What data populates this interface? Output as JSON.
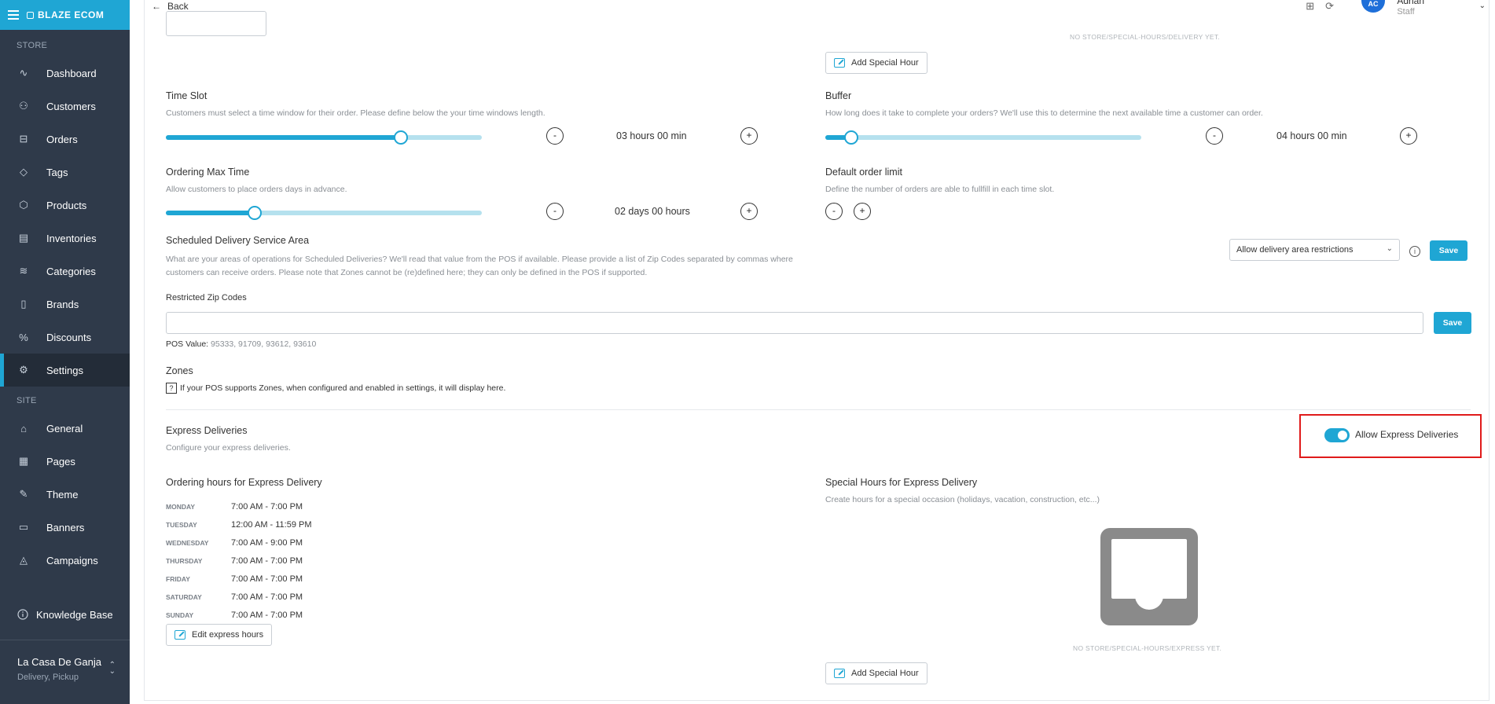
{
  "brand": {
    "name": "BLAZE ECOM"
  },
  "sidebar": {
    "store_section": "STORE",
    "site_section": "SITE",
    "store_items": [
      {
        "label": "Dashboard",
        "icon": "activity-icon"
      },
      {
        "label": "Customers",
        "icon": "users-icon"
      },
      {
        "label": "Orders",
        "icon": "inbox-icon"
      },
      {
        "label": "Tags",
        "icon": "tag-icon"
      },
      {
        "label": "Products",
        "icon": "box-icon"
      },
      {
        "label": "Inventories",
        "icon": "clipboard-icon"
      },
      {
        "label": "Categories",
        "icon": "layers-icon"
      },
      {
        "label": "Brands",
        "icon": "book-icon"
      },
      {
        "label": "Discounts",
        "icon": "percent-icon"
      },
      {
        "label": "Settings",
        "icon": "gear-icon",
        "active": true
      }
    ],
    "site_items": [
      {
        "label": "General",
        "icon": "home-icon"
      },
      {
        "label": "Pages",
        "icon": "layout-icon"
      },
      {
        "label": "Theme",
        "icon": "brush-icon"
      },
      {
        "label": "Banners",
        "icon": "monitor-icon"
      },
      {
        "label": "Campaigns",
        "icon": "bell-icon"
      }
    ],
    "knowledge_base": "Knowledge Base",
    "store": {
      "name": "La Casa De Ganja",
      "sub": "Delivery, Pickup"
    }
  },
  "topbar": {
    "back_label": "Back",
    "user_initials": "AC",
    "user_name": "Adrian",
    "user_role": "Staff"
  },
  "scheduled": {
    "empty_label": "NO STORE/SPECIAL-HOURS/DELIVERY YET.",
    "add_special_hour": "Add Special Hour",
    "time_slot": {
      "title": "Time Slot",
      "desc": "Customers must select a time window for their order. Please define below the your time windows length.",
      "value": "03 hours 00 min",
      "fill": 0.745
    },
    "buffer": {
      "title": "Buffer",
      "desc": "How long does it take to complete your orders? We'll use this to determine the next available time a customer can order.",
      "value": "04 hours 00 min",
      "fill": 0.082
    },
    "max_time": {
      "title": "Ordering Max Time",
      "desc": "Allow customers to place orders days in advance.",
      "value": "02 days 00 hours",
      "fill": 0.282
    },
    "order_limit": {
      "title": "Default order limit",
      "desc": "Define the number of orders are able to fullfill in each time slot."
    },
    "service_area": {
      "title": "Scheduled Delivery Service Area",
      "desc": "What are your areas of operations for Scheduled Deliveries? We'll read that value from the POS if available. Please provide a list of Zip Codes separated by commas where customers can receive orders. Please note that Zones cannot be (re)defined here; they can only be defined in the POS if supported.",
      "select_value": "Allow delivery area restrictions",
      "save": "Save"
    },
    "zip": {
      "label": "Restricted Zip Codes",
      "value": "",
      "save": "Save",
      "pos_label": "POS Value:",
      "pos_value": "95333, 91709, 93612, 93610"
    },
    "zones": {
      "title": "Zones",
      "desc": "If your POS supports Zones, when configured and enabled in settings, it will display here."
    }
  },
  "express": {
    "title": "Express Deliveries",
    "desc": "Configure your express deliveries.",
    "toggle_label": "Allow Express Deliveries",
    "hours_title": "Ordering hours for Express Delivery",
    "days": [
      {
        "day": "MONDAY",
        "hours": "7:00 AM - 7:00 PM"
      },
      {
        "day": "TUESDAY",
        "hours": "12:00 AM - 11:59 PM"
      },
      {
        "day": "WEDNESDAY",
        "hours": "7:00 AM - 9:00 PM"
      },
      {
        "day": "THURSDAY",
        "hours": "7:00 AM - 7:00 PM"
      },
      {
        "day": "FRIDAY",
        "hours": "7:00 AM - 7:00 PM"
      },
      {
        "day": "SATURDAY",
        "hours": "7:00 AM - 7:00 PM"
      },
      {
        "day": "SUNDAY",
        "hours": "7:00 AM - 7:00 PM"
      }
    ],
    "edit_hours": "Edit express hours",
    "special_title": "Special Hours for Express Delivery",
    "special_desc": "Create hours for a special occasion (holidays, vacation, construction, etc...)",
    "empty_label": "NO STORE/SPECIAL-HOURS/EXPRESS YET.",
    "add_special_hour": "Add Special Hour"
  },
  "colors": {
    "accent": "#1fa6d4",
    "sidebar": "#2f3a4a",
    "highlight": "#e01b1b"
  }
}
